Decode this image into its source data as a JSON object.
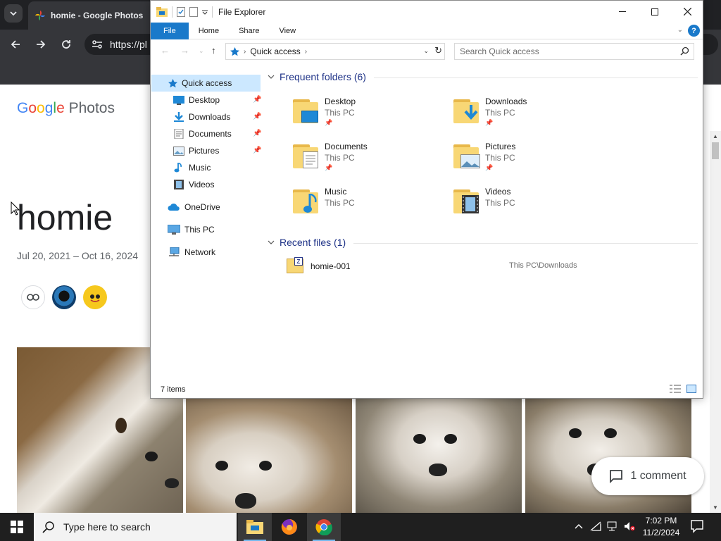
{
  "browser": {
    "tab_title": "homie - Google Photos",
    "url_partial": "https://pl"
  },
  "photos": {
    "logo_google": "Google",
    "logo_photos": "Photos",
    "album_title": "homie",
    "date_range": "Jul 20, 2021 – Oct 16, 2024",
    "comment_label": "1 comment"
  },
  "explorer": {
    "window_title": "File Explorer",
    "ribbon_tabs": [
      "File",
      "Home",
      "Share",
      "View"
    ],
    "address_location": "Quick access",
    "search_placeholder": "Search Quick access",
    "nav": {
      "quick_access": "Quick access",
      "desktop": "Desktop",
      "downloads": "Downloads",
      "documents": "Documents",
      "pictures": "Pictures",
      "music": "Music",
      "videos": "Videos",
      "onedrive": "OneDrive",
      "this_pc": "This PC",
      "network": "Network"
    },
    "frequent_header": "Frequent folders (6)",
    "folders": [
      {
        "name": "Desktop",
        "location": "This PC"
      },
      {
        "name": "Downloads",
        "location": "This PC"
      },
      {
        "name": "Documents",
        "location": "This PC"
      },
      {
        "name": "Pictures",
        "location": "This PC"
      },
      {
        "name": "Music",
        "location": "This PC"
      },
      {
        "name": "Videos",
        "location": "This PC"
      }
    ],
    "recent_header": "Recent files (1)",
    "recent_files": [
      {
        "name": "homie-001",
        "path": "This PC\\Downloads"
      }
    ],
    "status": "7 items"
  },
  "taskbar": {
    "search_placeholder": "Type here to search",
    "time": "7:02 PM",
    "date": "11/2/2024"
  },
  "colors": {
    "ribbon_file": "#1979ca",
    "nav_selected": "#cce8ff",
    "group_header": "#1e3287",
    "taskbar": "#1f1f1f"
  }
}
